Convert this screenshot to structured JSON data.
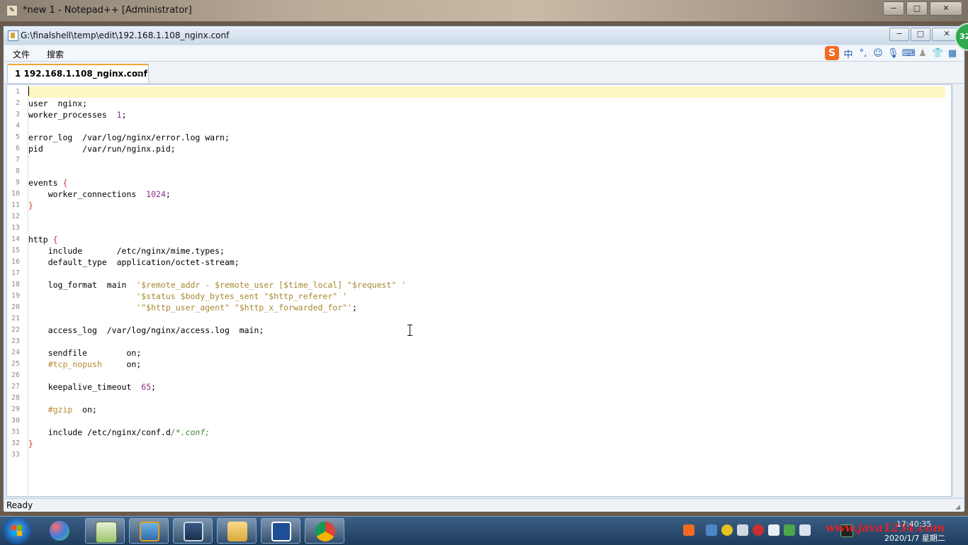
{
  "background_window": {
    "title": "*new 1 - Notepad++ [Administrator]"
  },
  "window": {
    "title": "G:\\finalshell\\temp\\edit\\192.168.1.108_nginx.conf",
    "controls": {
      "minimize": "−",
      "maximize": "□",
      "close": "✕"
    }
  },
  "badge": {
    "value": "32"
  },
  "menu": {
    "file": "文件",
    "search": "搜索"
  },
  "ime": {
    "logo": "S",
    "lang": "中",
    "punct": "°,"
  },
  "tab": {
    "label": "1 192.168.1.108_nginx.conf",
    "close": "×"
  },
  "code_lines": [
    "",
    "user  nginx;",
    "worker_processes  1;",
    "",
    "error_log  /var/log/nginx/error.log warn;",
    "pid        /var/run/nginx.pid;",
    "",
    "",
    "events {",
    "    worker_connections  1024;",
    "}",
    "",
    "",
    "http {",
    "    include       /etc/nginx/mime.types;",
    "    default_type  application/octet-stream;",
    "",
    "    log_format  main  '$remote_addr - $remote_user [$time_local] \"$request\" '",
    "                      '$status $body_bytes_sent \"$http_referer\" '",
    "                      '\"$http_user_agent\" \"$http_x_forwarded_for\"';",
    "",
    "    access_log  /var/log/nginx/access.log  main;",
    "",
    "    sendfile        on;",
    "    #tcp_nopush     on;",
    "",
    "    keepalive_timeout  65;",
    "",
    "    #gzip  on;",
    "",
    "    include /etc/nginx/conf.d/*.conf;",
    "}",
    ""
  ],
  "status": {
    "text": "Ready"
  },
  "taskbar": {
    "watermark": "www.java1234.com",
    "time": "17:40:35",
    "date": "2020/1/7 星期二"
  },
  "colors": {
    "brace": "#c0392b",
    "number": "#8b2f8b",
    "string": "#a7872e",
    "comment": "#b48a2b",
    "current_line": "#fdf7c3"
  }
}
